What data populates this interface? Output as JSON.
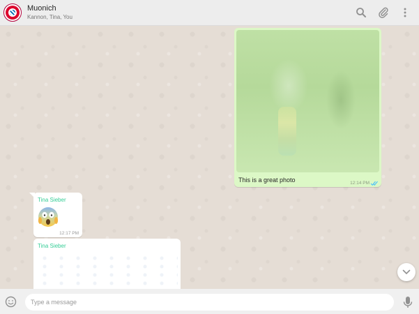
{
  "header": {
    "chat_name": "Muonich",
    "members": "Kannon, Tina, You",
    "icons": [
      "search-icon",
      "attach-icon",
      "menu-icon"
    ]
  },
  "messages": [
    {
      "direction": "outgoing",
      "type": "image",
      "caption": "This is a great photo",
      "time": "12:14 PM",
      "status": "read"
    },
    {
      "direction": "incoming",
      "sender": "Tina Sieber",
      "type": "emoji",
      "emoji": "face-screaming-in-fear",
      "time": "12:17 PM"
    },
    {
      "direction": "incoming",
      "sender": "Tina Sieber",
      "type": "image"
    }
  ],
  "composer": {
    "placeholder": "Type a message"
  },
  "colors": {
    "outgoing_bubble": "#dcf8c6",
    "incoming_bubble": "#ffffff",
    "sender_name": "#35cd96",
    "read_ticks": "#4fc3f7",
    "chat_background": "#e5ddd5"
  }
}
